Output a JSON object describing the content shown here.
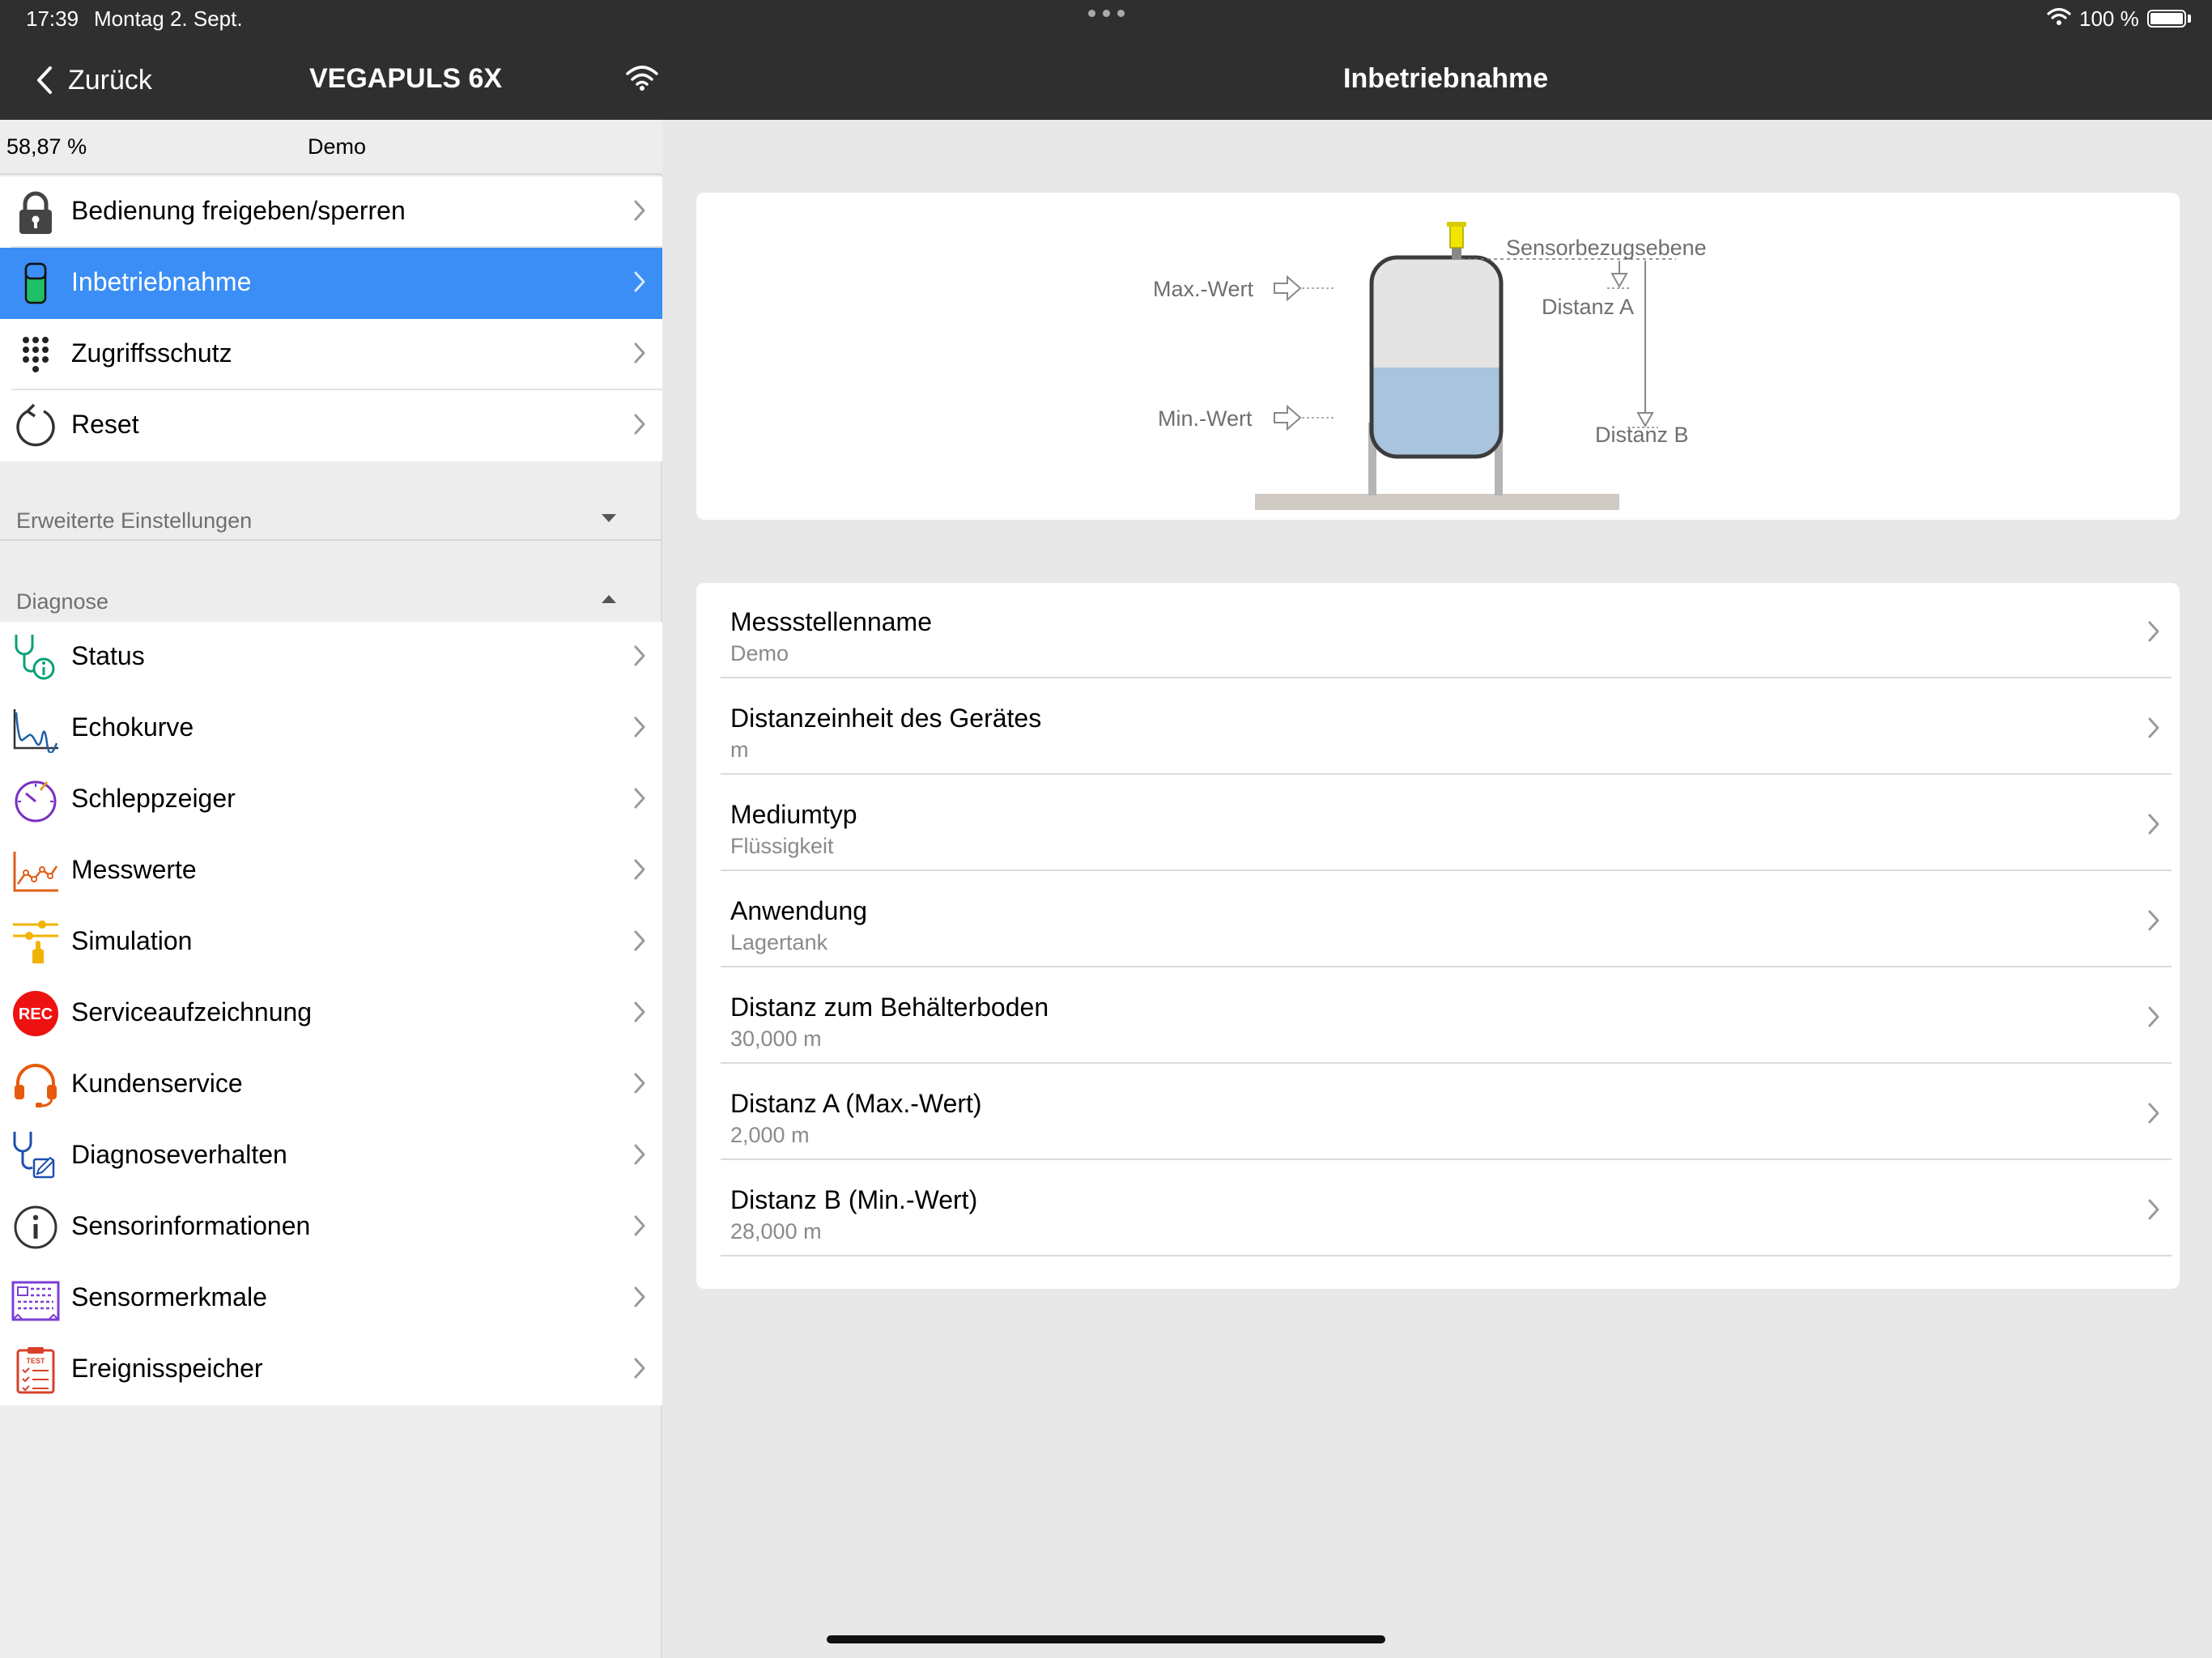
{
  "status_bar": {
    "time": "17:39",
    "date": "Montag 2. Sept.",
    "battery": "100 %"
  },
  "nav": {
    "back_label": "Zurück",
    "device_title": "VEGAPULS 6X",
    "page_title": "Inbetriebnahme"
  },
  "sidebar": {
    "level": "58,87 %",
    "tag_name": "Demo",
    "top_items": [
      {
        "label": "Bedienung freigeben/sperren",
        "icon": "lock-icon"
      },
      {
        "label": "Inbetriebnahme",
        "icon": "setup-icon",
        "active": true
      },
      {
        "label": "Zugriffsschutz",
        "icon": "keypad-icon"
      },
      {
        "label": "Reset",
        "icon": "reset-icon"
      }
    ],
    "extended_header": "Erweiterte Einstellungen",
    "diagnosis_header": "Diagnose",
    "diagnosis_items": [
      {
        "label": "Status",
        "icon": "stethoscope-info-icon"
      },
      {
        "label": "Echokurve",
        "icon": "echo-curve-icon"
      },
      {
        "label": "Schleppzeiger",
        "icon": "peak-indicator-icon"
      },
      {
        "label": "Messwerte",
        "icon": "measured-values-icon"
      },
      {
        "label": "Simulation",
        "icon": "simulation-icon"
      },
      {
        "label": "Serviceaufzeichnung",
        "icon": "rec-icon",
        "badge": "REC"
      },
      {
        "label": "Kundenservice",
        "icon": "headset-icon"
      },
      {
        "label": "Diagnoseverhalten",
        "icon": "stethoscope-edit-icon"
      },
      {
        "label": "Sensorinformationen",
        "icon": "info-icon"
      },
      {
        "label": "Sensormerkmale",
        "icon": "sensor-features-icon"
      },
      {
        "label": "Ereignisspeicher",
        "icon": "event-memory-icon",
        "badge": "TEST"
      }
    ]
  },
  "diagram": {
    "max_label": "Max.-Wert",
    "min_label": "Min.-Wert",
    "ref_label": "Sensorbezugsebene",
    "dist_a_label": "Distanz A",
    "dist_b_label": "Distanz B"
  },
  "settings": [
    {
      "title": "Messstellenname",
      "value": "Demo"
    },
    {
      "title": "Distanzeinheit des Gerätes",
      "value": "m"
    },
    {
      "title": "Mediumtyp",
      "value": "Flüssigkeit"
    },
    {
      "title": "Anwendung",
      "value": "Lagertank"
    },
    {
      "title": "Distanz zum Behälterboden",
      "value": "30,000 m"
    },
    {
      "title": "Distanz A (Max.-Wert)",
      "value": "2,000 m"
    },
    {
      "title": "Distanz B (Min.-Wert)",
      "value": "28,000 m"
    }
  ],
  "colors": {
    "accent": "#3a8ef5",
    "topbar": "#2f2f2f",
    "background": "#e8e8e8"
  }
}
